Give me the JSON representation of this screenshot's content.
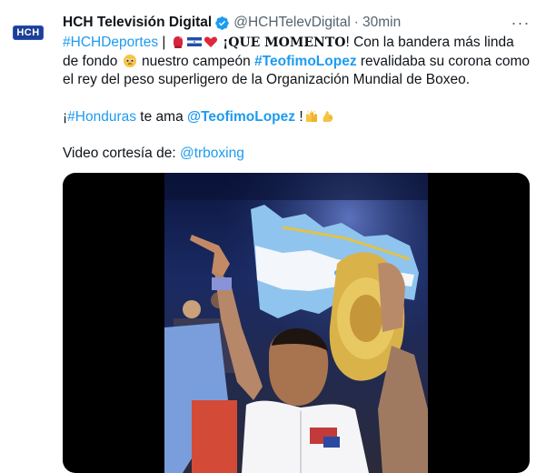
{
  "tweet": {
    "display_name": "HCH Televisión Digital",
    "handle": "@HCHTelevDigital",
    "separator": "·",
    "time": "30min",
    "more_label": "···",
    "avatar_text": "HCH",
    "line1": {
      "hashtag": "#HCHDeportes",
      "pipe": " |",
      "momento": "¡QUE MOMENTO",
      "after": "! Con la bandera más linda de fondo",
      "campeon": " nuestro campeón ",
      "mention_tag": "#TeofimoLopez",
      "rest": " revalidaba su corona como el rey del peso superligero de la Organización Mundial de Boxeo."
    },
    "line2": {
      "prefix": "¡",
      "hashtag": "#Honduras",
      "middle": " te ama ",
      "mention": "@TeofimoLopez",
      "suffix": " !"
    },
    "line3": {
      "prefix": "Video cortesía de: ",
      "mention": "@trboxing"
    }
  },
  "colors": {
    "link": "#1d9bf0",
    "verified": "#1d9bf0",
    "secondary_text": "#536471",
    "flag_blue": "#5fa8e6"
  },
  "icons": {
    "verified": "verified-badge-icon",
    "more": "more-horizontal-icon",
    "glove": "boxing-glove-emoji",
    "flag": "honduras-flag-emoji",
    "heart": "red-heart-emoji",
    "pleading": "pleading-face-emoji",
    "raised_hands": "raising-hands-emoji",
    "biceps": "flexed-biceps-emoji"
  }
}
